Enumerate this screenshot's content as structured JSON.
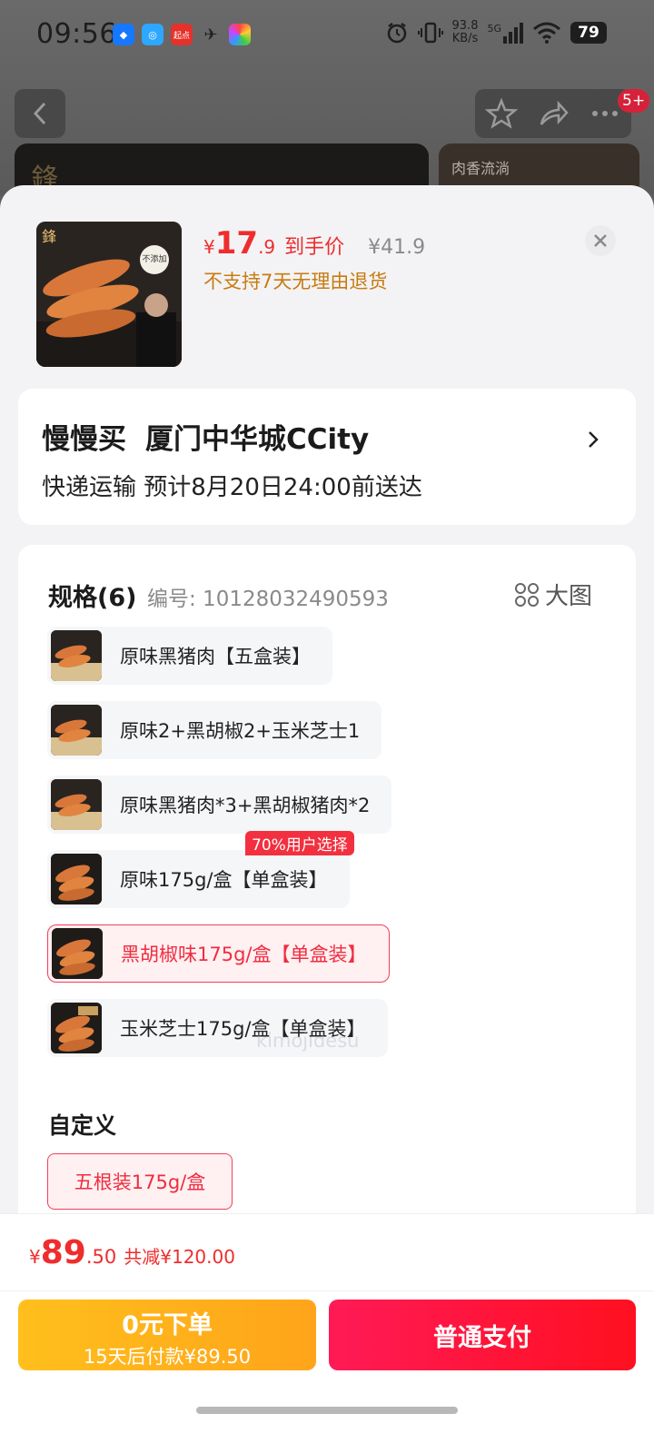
{
  "status_bar": {
    "time": "09:56",
    "net_speed_value": "93.8",
    "net_speed_unit": "KB/s",
    "signal": "5G",
    "battery": "79",
    "app_icon_qidian": "起点"
  },
  "header": {
    "cart_badge": "5+",
    "banner_right_text": "肉香流淌"
  },
  "product": {
    "currency": "¥",
    "price_int": "17",
    "price_dec": ".9",
    "price_tag": "到手价",
    "original_price": "¥41.9",
    "return_policy": "不支持7天无理由退货",
    "thumb_badge": "不添加"
  },
  "address": {
    "name": "慢慢买",
    "place": "厦门中华城CCity",
    "delivery": "快递运输 预计8月20日24:00前送达"
  },
  "spec": {
    "title": "规格",
    "count": "(6)",
    "number": "编号: 10128032490593",
    "big_image_label": "大图",
    "popular_badge": "70%用户选择",
    "options": [
      {
        "label": "原味黑猪肉【五盒装】",
        "selected": false
      },
      {
        "label": "原味2+黑胡椒2+玉米芝士1",
        "selected": false
      },
      {
        "label": "原味黑猪肉*3+黑胡椒猪肉*2",
        "selected": false
      },
      {
        "label": "原味175g/盒【单盒装】",
        "selected": false
      },
      {
        "label": "黑胡椒味175g/盒【单盒装】",
        "selected": true
      },
      {
        "label": "玉米芝士175g/盒【单盒装】",
        "selected": false
      }
    ]
  },
  "custom": {
    "title": "自定义",
    "option": "五根装175g/盒"
  },
  "watermark": "kimojidesu",
  "footer": {
    "currency": "¥",
    "total_int": "89",
    "total_dec": ".50",
    "discount": "共减¥120.00",
    "zero_pay_main": "0元下单",
    "zero_pay_sub": "15天后付款¥89.50",
    "normal_pay": "普通支付"
  },
  "colors": {
    "accent_red": "#ef2d2d",
    "policy_orange": "#c87b10",
    "btn_yellow": "#ffb21b",
    "btn_red": "#ff1a3c"
  }
}
